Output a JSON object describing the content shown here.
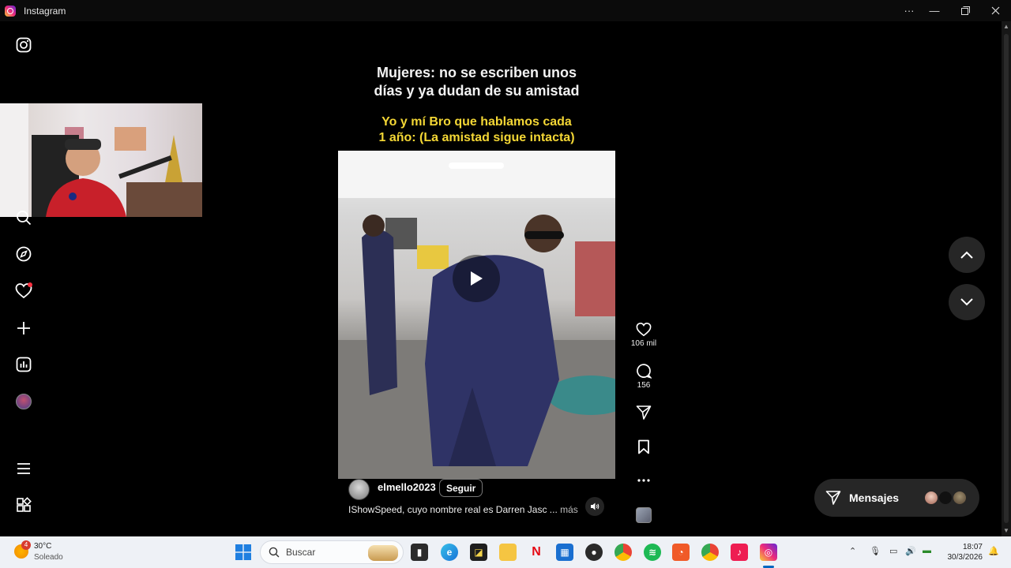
{
  "window": {
    "title": "Instagram"
  },
  "reel": {
    "caption_white": "Mujeres: no se escriben unos días y ya dudan de su amistad",
    "caption_yellow": "Yo y mí Bro que hablamos cada 1 año: (La amistad sigue intacta)",
    "author": "elmello2023",
    "follow_label": "Seguir",
    "description": "IShowSpeed, cuyo nombre real es Darren Jasc ...",
    "more_label": "más",
    "likes": "106 mil",
    "comments": "156"
  },
  "messages": {
    "label": "Mensajes"
  },
  "taskbar": {
    "weather_temp": "30°C",
    "weather_desc": "Soleado",
    "weather_badge": "4",
    "search_placeholder": "Buscar",
    "time": "18:07",
    "date": "30/3/2026"
  },
  "colors": {
    "accent_like": "#ff3040",
    "caption_yellow": "#f4d735",
    "taskbar_bg": "#eef1f6"
  },
  "icons": [
    "instagram-icon",
    "search-icon",
    "explore-icon",
    "heart-icon",
    "plus-icon",
    "insights-icon",
    "profile-avatar",
    "menu-icon",
    "apps-icon",
    "play-icon",
    "comment-icon",
    "send-icon",
    "bookmark-icon",
    "more-icon",
    "volume-icon",
    "chevron-up-icon",
    "chevron-down-icon"
  ]
}
